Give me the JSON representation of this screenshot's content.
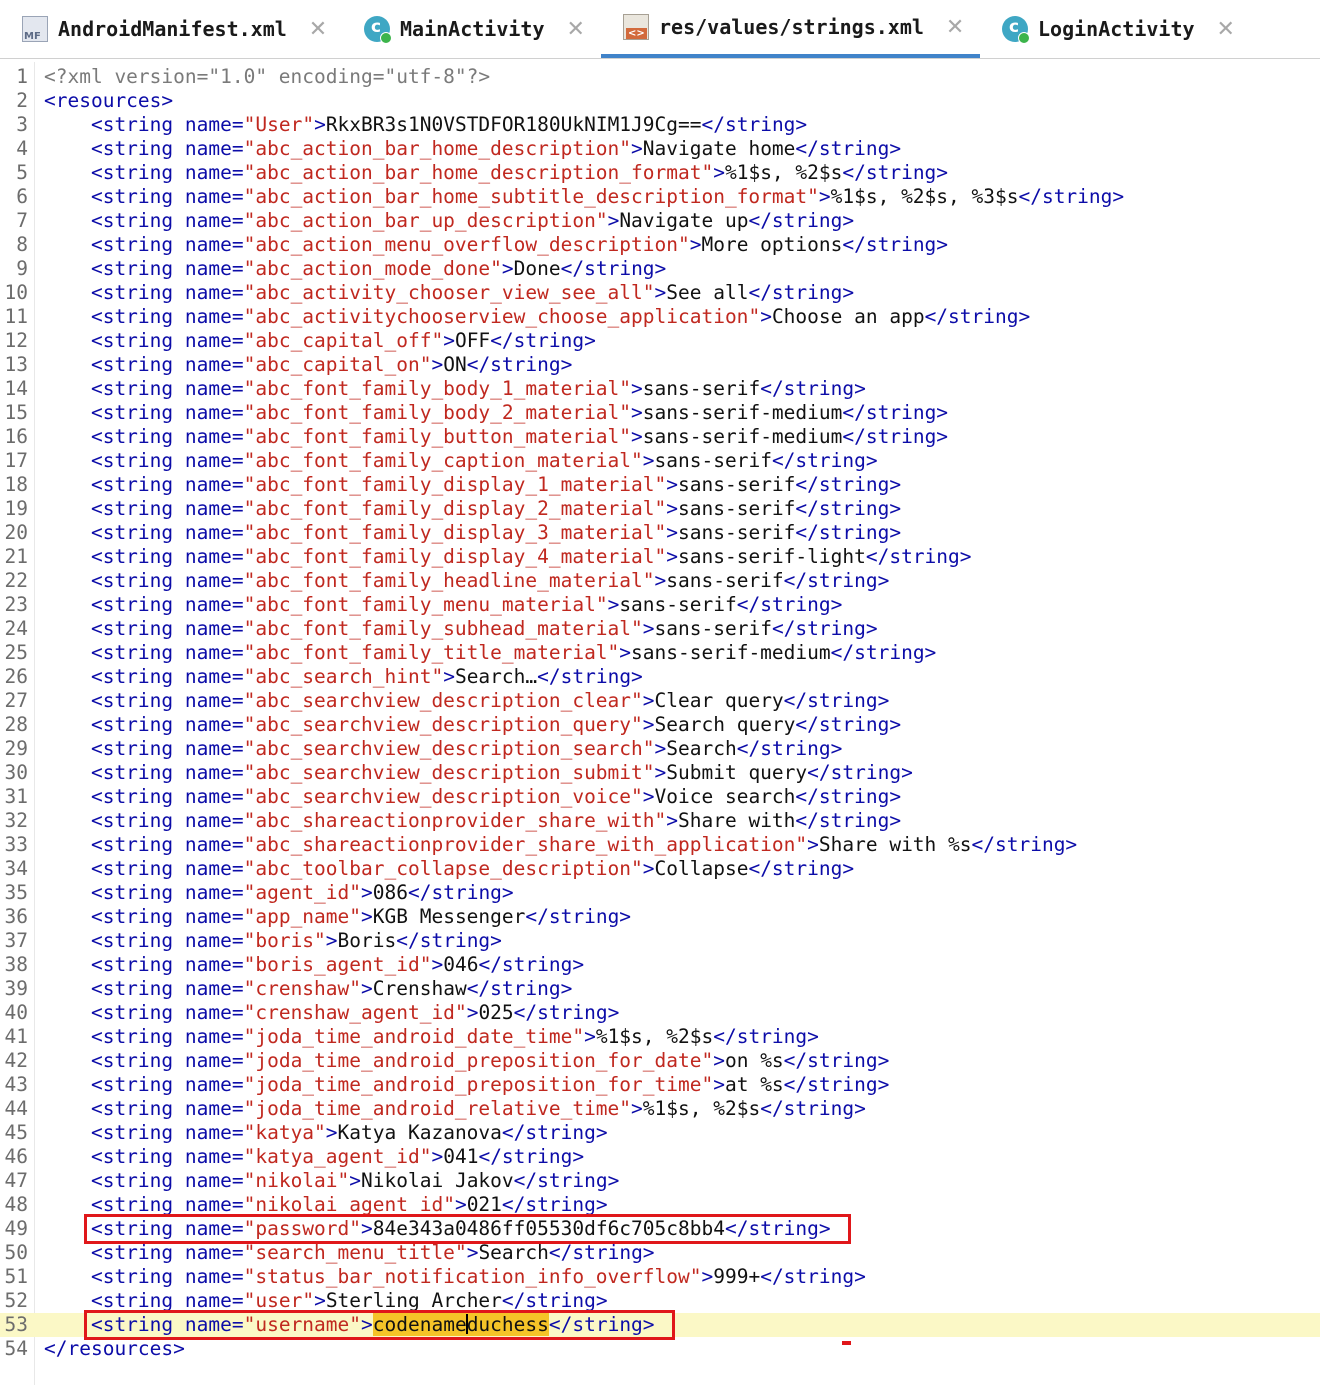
{
  "tabs": [
    {
      "label": "AndroidManifest.xml",
      "icon": "manifest-file-icon",
      "active": false
    },
    {
      "label": "MainActivity",
      "icon": "class-icon",
      "active": false
    },
    {
      "label": "res/values/strings.xml",
      "icon": "xml-file-icon",
      "active": true
    },
    {
      "label": "LoginActivity",
      "icon": "class-icon",
      "active": false
    }
  ],
  "editor": {
    "xml_declaration": "<?xml version=\"1.0\" encoding=\"utf-8\"?>",
    "root_open": "<resources>",
    "root_close": "</resources>",
    "strings": [
      {
        "name": "User",
        "value": "RkxBR3s1N0VSTDFOR180UkNIM1J9Cg=="
      },
      {
        "name": "abc_action_bar_home_description",
        "value": "Navigate home"
      },
      {
        "name": "abc_action_bar_home_description_format",
        "value": "%1$s, %2$s"
      },
      {
        "name": "abc_action_bar_home_subtitle_description_format",
        "value": "%1$s, %2$s, %3$s"
      },
      {
        "name": "abc_action_bar_up_description",
        "value": "Navigate up"
      },
      {
        "name": "abc_action_menu_overflow_description",
        "value": "More options"
      },
      {
        "name": "abc_action_mode_done",
        "value": "Done"
      },
      {
        "name": "abc_activity_chooser_view_see_all",
        "value": "See all"
      },
      {
        "name": "abc_activitychooserview_choose_application",
        "value": "Choose an app"
      },
      {
        "name": "abc_capital_off",
        "value": "OFF"
      },
      {
        "name": "abc_capital_on",
        "value": "ON"
      },
      {
        "name": "abc_font_family_body_1_material",
        "value": "sans-serif"
      },
      {
        "name": "abc_font_family_body_2_material",
        "value": "sans-serif-medium"
      },
      {
        "name": "abc_font_family_button_material",
        "value": "sans-serif-medium"
      },
      {
        "name": "abc_font_family_caption_material",
        "value": "sans-serif"
      },
      {
        "name": "abc_font_family_display_1_material",
        "value": "sans-serif"
      },
      {
        "name": "abc_font_family_display_2_material",
        "value": "sans-serif"
      },
      {
        "name": "abc_font_family_display_3_material",
        "value": "sans-serif"
      },
      {
        "name": "abc_font_family_display_4_material",
        "value": "sans-serif-light"
      },
      {
        "name": "abc_font_family_headline_material",
        "value": "sans-serif"
      },
      {
        "name": "abc_font_family_menu_material",
        "value": "sans-serif"
      },
      {
        "name": "abc_font_family_subhead_material",
        "value": "sans-serif"
      },
      {
        "name": "abc_font_family_title_material",
        "value": "sans-serif-medium"
      },
      {
        "name": "abc_search_hint",
        "value": "Search…"
      },
      {
        "name": "abc_searchview_description_clear",
        "value": "Clear query"
      },
      {
        "name": "abc_searchview_description_query",
        "value": "Search query"
      },
      {
        "name": "abc_searchview_description_search",
        "value": "Search"
      },
      {
        "name": "abc_searchview_description_submit",
        "value": "Submit query"
      },
      {
        "name": "abc_searchview_description_voice",
        "value": "Voice search"
      },
      {
        "name": "abc_shareactionprovider_share_with",
        "value": "Share with"
      },
      {
        "name": "abc_shareactionprovider_share_with_application",
        "value": "Share with %s"
      },
      {
        "name": "abc_toolbar_collapse_description",
        "value": "Collapse"
      },
      {
        "name": "agent_id",
        "value": "086"
      },
      {
        "name": "app_name",
        "value": "KGB Messenger"
      },
      {
        "name": "boris",
        "value": "Boris"
      },
      {
        "name": "boris_agent_id",
        "value": "046"
      },
      {
        "name": "crenshaw",
        "value": "Crenshaw"
      },
      {
        "name": "crenshaw_agent_id",
        "value": "025"
      },
      {
        "name": "joda_time_android_date_time",
        "value": "%1$s, %2$s"
      },
      {
        "name": "joda_time_android_preposition_for_date",
        "value": "on %s"
      },
      {
        "name": "joda_time_android_preposition_for_time",
        "value": "at %s"
      },
      {
        "name": "joda_time_android_relative_time",
        "value": "%1$s, %2$s"
      },
      {
        "name": "katya",
        "value": "Katya Kazanova"
      },
      {
        "name": "katya_agent_id",
        "value": "041"
      },
      {
        "name": "nikolai",
        "value": "Nikolai Jakov"
      },
      {
        "name": "nikolai_agent_id",
        "value": "021"
      },
      {
        "name": "password",
        "value": "84e343a0486ff05530df6c705c8bb4"
      },
      {
        "name": "search_menu_title",
        "value": "Search"
      },
      {
        "name": "status_bar_notification_info_overflow",
        "value": "999+"
      },
      {
        "name": "user",
        "value": "Sterling Archer"
      },
      {
        "name": "username",
        "value": "codenameduchess"
      }
    ],
    "current_line": 53,
    "highlighted_lines": [
      49,
      53
    ],
    "selected_text": "codenameduchess",
    "colors": {
      "tag": "#0c0ca8",
      "attr_value": "#c0281f",
      "current_line_bg": "#fbf8c6",
      "selection": "#f5c428",
      "annotation_box": "#e0171a",
      "active_tab_underline": "#4083c9"
    }
  }
}
